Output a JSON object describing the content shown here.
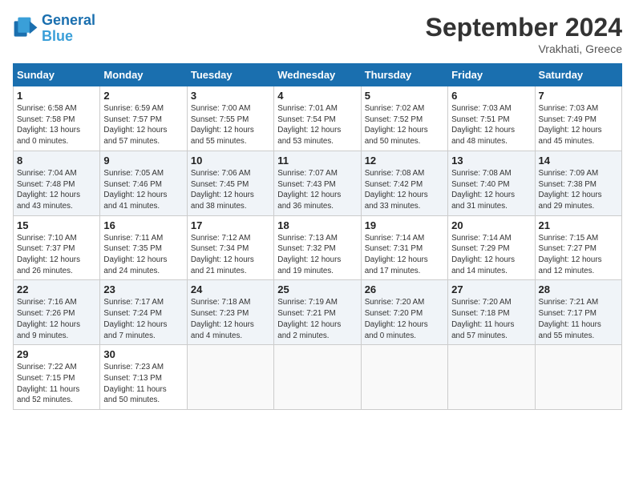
{
  "header": {
    "logo_line1": "General",
    "logo_line2": "Blue",
    "month": "September 2024",
    "location": "Vrakhati, Greece"
  },
  "weekdays": [
    "Sunday",
    "Monday",
    "Tuesday",
    "Wednesday",
    "Thursday",
    "Friday",
    "Saturday"
  ],
  "weeks": [
    [
      {
        "day": "1",
        "info": "Sunrise: 6:58 AM\nSunset: 7:58 PM\nDaylight: 13 hours\nand 0 minutes."
      },
      {
        "day": "2",
        "info": "Sunrise: 6:59 AM\nSunset: 7:57 PM\nDaylight: 12 hours\nand 57 minutes."
      },
      {
        "day": "3",
        "info": "Sunrise: 7:00 AM\nSunset: 7:55 PM\nDaylight: 12 hours\nand 55 minutes."
      },
      {
        "day": "4",
        "info": "Sunrise: 7:01 AM\nSunset: 7:54 PM\nDaylight: 12 hours\nand 53 minutes."
      },
      {
        "day": "5",
        "info": "Sunrise: 7:02 AM\nSunset: 7:52 PM\nDaylight: 12 hours\nand 50 minutes."
      },
      {
        "day": "6",
        "info": "Sunrise: 7:03 AM\nSunset: 7:51 PM\nDaylight: 12 hours\nand 48 minutes."
      },
      {
        "day": "7",
        "info": "Sunrise: 7:03 AM\nSunset: 7:49 PM\nDaylight: 12 hours\nand 45 minutes."
      }
    ],
    [
      {
        "day": "8",
        "info": "Sunrise: 7:04 AM\nSunset: 7:48 PM\nDaylight: 12 hours\nand 43 minutes."
      },
      {
        "day": "9",
        "info": "Sunrise: 7:05 AM\nSunset: 7:46 PM\nDaylight: 12 hours\nand 41 minutes."
      },
      {
        "day": "10",
        "info": "Sunrise: 7:06 AM\nSunset: 7:45 PM\nDaylight: 12 hours\nand 38 minutes."
      },
      {
        "day": "11",
        "info": "Sunrise: 7:07 AM\nSunset: 7:43 PM\nDaylight: 12 hours\nand 36 minutes."
      },
      {
        "day": "12",
        "info": "Sunrise: 7:08 AM\nSunset: 7:42 PM\nDaylight: 12 hours\nand 33 minutes."
      },
      {
        "day": "13",
        "info": "Sunrise: 7:08 AM\nSunset: 7:40 PM\nDaylight: 12 hours\nand 31 minutes."
      },
      {
        "day": "14",
        "info": "Sunrise: 7:09 AM\nSunset: 7:38 PM\nDaylight: 12 hours\nand 29 minutes."
      }
    ],
    [
      {
        "day": "15",
        "info": "Sunrise: 7:10 AM\nSunset: 7:37 PM\nDaylight: 12 hours\nand 26 minutes."
      },
      {
        "day": "16",
        "info": "Sunrise: 7:11 AM\nSunset: 7:35 PM\nDaylight: 12 hours\nand 24 minutes."
      },
      {
        "day": "17",
        "info": "Sunrise: 7:12 AM\nSunset: 7:34 PM\nDaylight: 12 hours\nand 21 minutes."
      },
      {
        "day": "18",
        "info": "Sunrise: 7:13 AM\nSunset: 7:32 PM\nDaylight: 12 hours\nand 19 minutes."
      },
      {
        "day": "19",
        "info": "Sunrise: 7:14 AM\nSunset: 7:31 PM\nDaylight: 12 hours\nand 17 minutes."
      },
      {
        "day": "20",
        "info": "Sunrise: 7:14 AM\nSunset: 7:29 PM\nDaylight: 12 hours\nand 14 minutes."
      },
      {
        "day": "21",
        "info": "Sunrise: 7:15 AM\nSunset: 7:27 PM\nDaylight: 12 hours\nand 12 minutes."
      }
    ],
    [
      {
        "day": "22",
        "info": "Sunrise: 7:16 AM\nSunset: 7:26 PM\nDaylight: 12 hours\nand 9 minutes."
      },
      {
        "day": "23",
        "info": "Sunrise: 7:17 AM\nSunset: 7:24 PM\nDaylight: 12 hours\nand 7 minutes."
      },
      {
        "day": "24",
        "info": "Sunrise: 7:18 AM\nSunset: 7:23 PM\nDaylight: 12 hours\nand 4 minutes."
      },
      {
        "day": "25",
        "info": "Sunrise: 7:19 AM\nSunset: 7:21 PM\nDaylight: 12 hours\nand 2 minutes."
      },
      {
        "day": "26",
        "info": "Sunrise: 7:20 AM\nSunset: 7:20 PM\nDaylight: 12 hours\nand 0 minutes."
      },
      {
        "day": "27",
        "info": "Sunrise: 7:20 AM\nSunset: 7:18 PM\nDaylight: 11 hours\nand 57 minutes."
      },
      {
        "day": "28",
        "info": "Sunrise: 7:21 AM\nSunset: 7:17 PM\nDaylight: 11 hours\nand 55 minutes."
      }
    ],
    [
      {
        "day": "29",
        "info": "Sunrise: 7:22 AM\nSunset: 7:15 PM\nDaylight: 11 hours\nand 52 minutes."
      },
      {
        "day": "30",
        "info": "Sunrise: 7:23 AM\nSunset: 7:13 PM\nDaylight: 11 hours\nand 50 minutes."
      },
      {
        "day": "",
        "info": ""
      },
      {
        "day": "",
        "info": ""
      },
      {
        "day": "",
        "info": ""
      },
      {
        "day": "",
        "info": ""
      },
      {
        "day": "",
        "info": ""
      }
    ]
  ]
}
